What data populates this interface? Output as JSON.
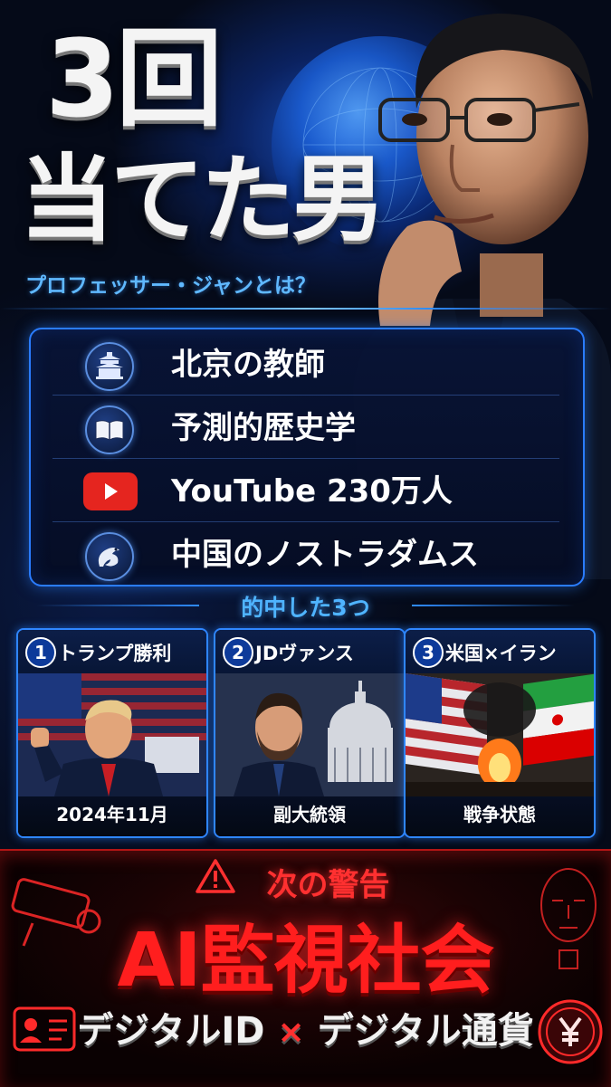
{
  "headline": {
    "line1": "3回",
    "line2": "当てた男"
  },
  "subtitle": "プロフェッサー・ジャンとは？",
  "profile": [
    {
      "icon": "temple-icon",
      "label": "北京の教師"
    },
    {
      "icon": "book-icon",
      "label": "予測的歴史学"
    },
    {
      "icon": "youtube-icon",
      "label": "YouTube 230万人"
    },
    {
      "icon": "dragon-icon",
      "label": "中国のノストラダムス"
    }
  ],
  "hits": {
    "title": "的中した3つ",
    "cards": [
      {
        "num": "1",
        "title": "トランプ勝利",
        "caption": "2024年11月"
      },
      {
        "num": "2",
        "title": "JDヴァンス",
        "caption": "副大統領"
      },
      {
        "num": "3",
        "title": "米国×イラン",
        "caption": "戦争状態"
      }
    ]
  },
  "warning": {
    "label": "次の警告",
    "title": "AI監視社会",
    "left": "デジタルID",
    "times": "×",
    "right": "デジタル通貨"
  },
  "colors": {
    "accent_blue": "#2f86ff",
    "accent_red": "#ff1e1e",
    "background": "#050a18"
  }
}
